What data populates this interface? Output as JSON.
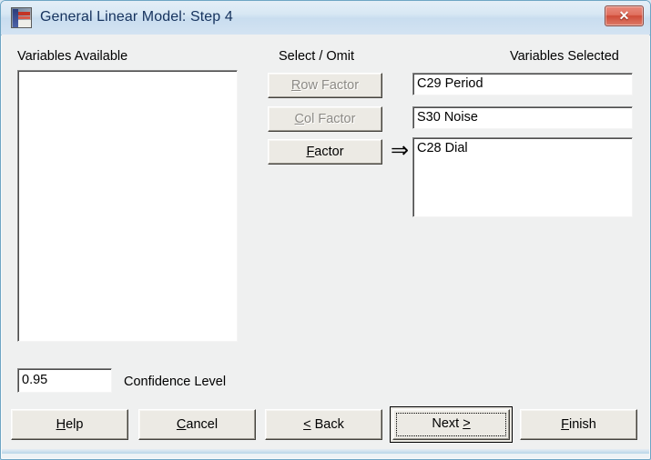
{
  "window": {
    "title": "General Linear Model: Step 4",
    "icon": "minitab-app-icon",
    "close_label": "✕"
  },
  "labels": {
    "variables_available": "Variables Available",
    "select_omit": "Select / Omit",
    "variables_selected": "Variables Selected",
    "confidence_level": "Confidence Level"
  },
  "lists": {
    "available": {
      "items": []
    }
  },
  "select_buttons": [
    {
      "label": "Row Factor",
      "accel": "R",
      "enabled": false
    },
    {
      "label": "Col Factor",
      "accel": "C",
      "enabled": false
    },
    {
      "label": "Factor",
      "accel": "F",
      "enabled": true
    }
  ],
  "arrow": "⇒",
  "selected_fields": [
    {
      "name": "row-factor-field",
      "value": "C29 Period"
    },
    {
      "name": "col-factor-field",
      "value": "S30 Noise"
    },
    {
      "name": "factor-field",
      "value": "C28 Dial"
    }
  ],
  "confidence": {
    "value": "0.95"
  },
  "footer_buttons": [
    {
      "label": "Help",
      "accel": "H",
      "default": false
    },
    {
      "label": "Cancel",
      "accel": "C",
      "default": false
    },
    {
      "label": "< Back",
      "accel": "<",
      "default": false
    },
    {
      "label": "Next >",
      "accel": ">",
      "default": true
    },
    {
      "label": "Finish",
      "accel": "F",
      "default": false
    }
  ],
  "colors": {
    "title_text": "#16335e",
    "dialog_face": "#eff0f0",
    "button_face": "#eceae4",
    "close_red": "#cf4b38",
    "disabled_text": "#8c8a85"
  }
}
